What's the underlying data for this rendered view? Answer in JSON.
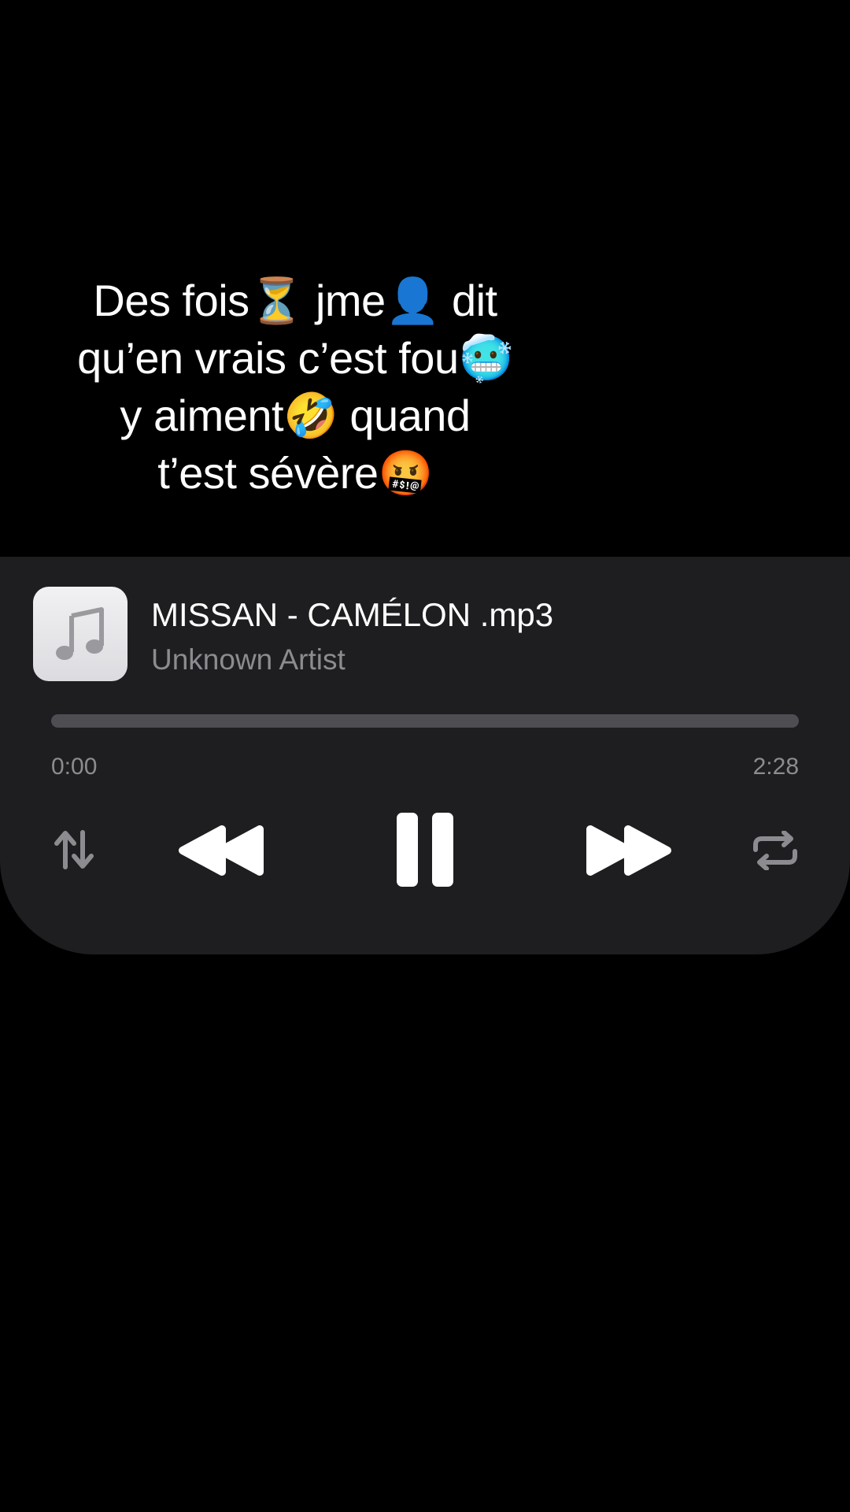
{
  "caption": {
    "lines": [
      "Des fois⏳ jme👤 dit",
      "qu’en vrais c’est fou🥶",
      "y aiment🤣 quand",
      "t’est sévère🤬"
    ]
  },
  "player": {
    "artwork_icon": "music-note-icon",
    "title": "MISSAN - CAMÉLON .mp3",
    "artist": "Unknown Artist",
    "progress": 0.0,
    "elapsed": "0:00",
    "duration": "2:28",
    "controls": {
      "sort": "sort-arrows-icon",
      "previous": "rewind-icon",
      "play_pause": "pause-icon",
      "next": "fast-forward-icon",
      "repeat": "repeat-icon"
    }
  },
  "colors": {
    "background": "#000000",
    "panel": "#1e1e20",
    "primary_text": "#ffffff",
    "secondary_text": "#8c8c90",
    "track": "#4e4e52"
  }
}
